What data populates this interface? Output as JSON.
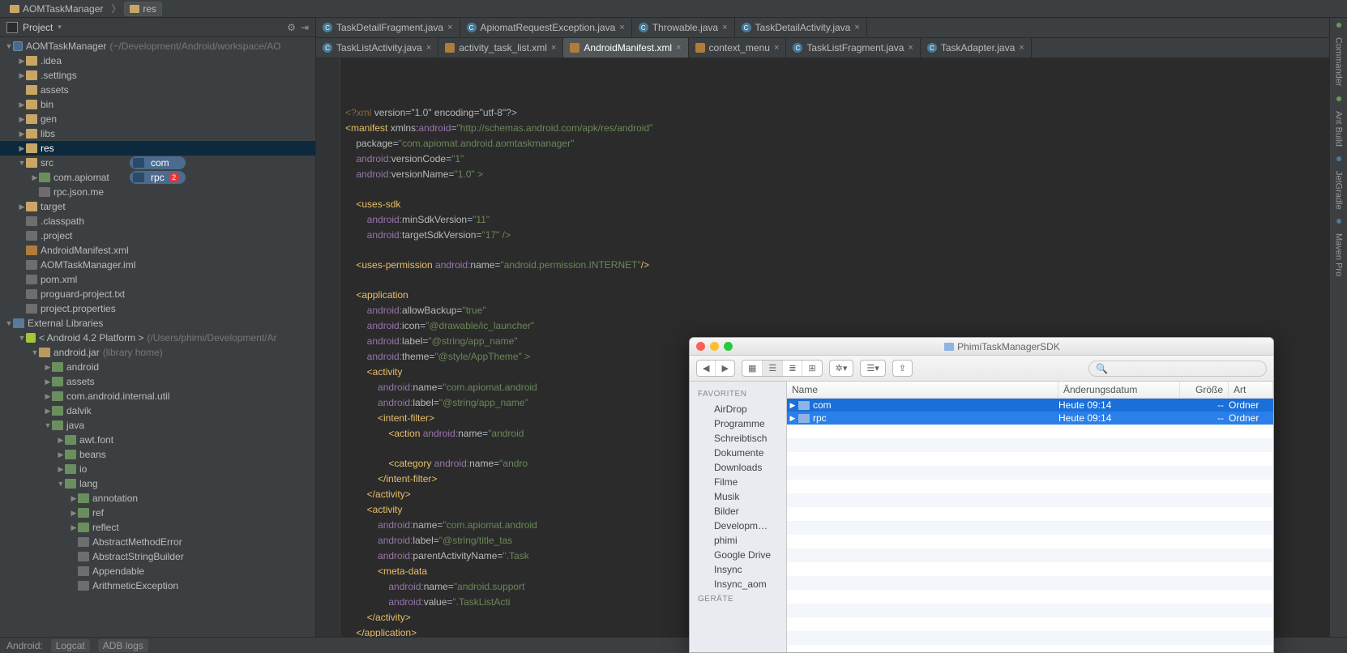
{
  "breadcrumbs": [
    "AOMTaskManager",
    "res"
  ],
  "projectPanel": {
    "title": "Project"
  },
  "tree": [
    {
      "d": 0,
      "t": "v",
      "ic": "module",
      "label": "AOMTaskManager",
      "dim": "(~/Development/Android/workspace/AO"
    },
    {
      "d": 1,
      "t": ">",
      "ic": "folder",
      "label": ".idea"
    },
    {
      "d": 1,
      "t": ">",
      "ic": "folder",
      "label": ".settings"
    },
    {
      "d": 1,
      "t": " ",
      "ic": "folder",
      "label": "assets"
    },
    {
      "d": 1,
      "t": ">",
      "ic": "folder",
      "label": "bin"
    },
    {
      "d": 1,
      "t": ">",
      "ic": "folder",
      "label": "gen"
    },
    {
      "d": 1,
      "t": ">",
      "ic": "folder",
      "label": "libs"
    },
    {
      "d": 1,
      "t": ">",
      "ic": "folder",
      "label": "res",
      "sel": true
    },
    {
      "d": 1,
      "t": "v",
      "ic": "folder",
      "label": "src"
    },
    {
      "d": 2,
      "t": ">",
      "ic": "pkg",
      "label": "com.apiomat"
    },
    {
      "d": 2,
      "t": " ",
      "ic": "file",
      "label": "rpc.json.me"
    },
    {
      "d": 1,
      "t": ">",
      "ic": "folder",
      "label": "target"
    },
    {
      "d": 1,
      "t": " ",
      "ic": "file",
      "label": ".classpath"
    },
    {
      "d": 1,
      "t": " ",
      "ic": "file",
      "label": ".project"
    },
    {
      "d": 1,
      "t": " ",
      "ic": "xml",
      "label": "AndroidManifest.xml"
    },
    {
      "d": 1,
      "t": " ",
      "ic": "file",
      "label": "AOMTaskManager.iml"
    },
    {
      "d": 1,
      "t": " ",
      "ic": "file",
      "label": "pom.xml"
    },
    {
      "d": 1,
      "t": " ",
      "ic": "file",
      "label": "proguard-project.txt"
    },
    {
      "d": 1,
      "t": " ",
      "ic": "file",
      "label": "project.properties"
    },
    {
      "d": 0,
      "t": "v",
      "ic": "lib",
      "label": "External Libraries"
    },
    {
      "d": 1,
      "t": "v",
      "ic": "robot",
      "label": "< Android 4.2 Platform >",
      "dim": "(/Users/phimi/Development/Ar"
    },
    {
      "d": 2,
      "t": "v",
      "ic": "jar",
      "label": "android.jar",
      "dim": "(library home)"
    },
    {
      "d": 3,
      "t": ">",
      "ic": "pkg",
      "label": "android"
    },
    {
      "d": 3,
      "t": ">",
      "ic": "pkg",
      "label": "assets"
    },
    {
      "d": 3,
      "t": ">",
      "ic": "pkg",
      "label": "com.android.internal.util"
    },
    {
      "d": 3,
      "t": ">",
      "ic": "pkg",
      "label": "dalvik"
    },
    {
      "d": 3,
      "t": "v",
      "ic": "pkg",
      "label": "java"
    },
    {
      "d": 4,
      "t": ">",
      "ic": "pkg",
      "label": "awt.font"
    },
    {
      "d": 4,
      "t": ">",
      "ic": "pkg",
      "label": "beans"
    },
    {
      "d": 4,
      "t": ">",
      "ic": "pkg",
      "label": "io"
    },
    {
      "d": 4,
      "t": "v",
      "ic": "pkg",
      "label": "lang"
    },
    {
      "d": 5,
      "t": ">",
      "ic": "pkg",
      "label": "annotation"
    },
    {
      "d": 5,
      "t": ">",
      "ic": "pkg",
      "label": "ref"
    },
    {
      "d": 5,
      "t": ">",
      "ic": "pkg",
      "label": "reflect"
    },
    {
      "d": 5,
      "t": " ",
      "ic": "file",
      "label": "AbstractMethodError"
    },
    {
      "d": 5,
      "t": " ",
      "ic": "file",
      "label": "AbstractStringBuilder"
    },
    {
      "d": 5,
      "t": " ",
      "ic": "file",
      "label": "Appendable"
    },
    {
      "d": 5,
      "t": " ",
      "ic": "file",
      "label": "ArithmeticException"
    }
  ],
  "chips": [
    {
      "label": "com"
    },
    {
      "label": "rpc",
      "badge": "2"
    }
  ],
  "tabsTop": [
    {
      "ic": "c",
      "label": "TaskDetailFragment.java"
    },
    {
      "ic": "c",
      "label": "ApiomatRequestException.java"
    },
    {
      "ic": "c",
      "label": "Throwable.java"
    },
    {
      "ic": "c",
      "label": "TaskDetailActivity.java"
    }
  ],
  "tabsBottom": [
    {
      "ic": "c",
      "label": "TaskListActivity.java"
    },
    {
      "ic": "x",
      "label": "activity_task_list.xml"
    },
    {
      "ic": "x",
      "label": "AndroidManifest.xml",
      "active": true
    },
    {
      "ic": "x",
      "label": "context_menu"
    },
    {
      "ic": "c",
      "label": "TaskListFragment.java"
    },
    {
      "ic": "c",
      "label": "TaskAdapter.java"
    }
  ],
  "status": {
    "items": [
      "Android:",
      "Logcat",
      "ADB logs"
    ]
  },
  "rstrip": [
    "Commander",
    "Ant Build",
    "JetGradle",
    "Maven Pro"
  ],
  "finder": {
    "title": "PhimiTaskManagerSDK",
    "favHead": "FAVORITEN",
    "devHead": "GERÄTE",
    "fav": [
      "AirDrop",
      "Programme",
      "Schreibtisch",
      "Dokumente",
      "Downloads",
      "Filme",
      "Musik",
      "Bilder",
      "Developm…",
      "phimi",
      "Google Drive",
      "Insync",
      "Insync_aom"
    ],
    "columns": [
      "Name",
      "Änderungsdatum",
      "Größe",
      "Art"
    ],
    "rows": [
      {
        "name": "com",
        "date": "Heute 09:14",
        "size": "--",
        "kind": "Ordner"
      },
      {
        "name": "rpc",
        "date": "Heute 09:14",
        "size": "--",
        "kind": "Ordner"
      }
    ],
    "searchPlaceholder": ""
  },
  "code": {
    "l01a": "<?xml ",
    "l01b": "version",
    "l01c": "=\"1.0\" ",
    "l01d": "encoding",
    "l01e": "=\"utf-8\"?>",
    "l02a": "<manifest ",
    "l02b": "xmlns:",
    "l02c": "android",
    "l02d": "=",
    "l02e": "\"http://schemas.android.com/apk/res/android\"",
    "l03a": "    package",
    "l03b": "=",
    "l03c": "\"com.apiomat.android.aomtaskmanager\"",
    "l04a": "    ",
    "l04b": "android:",
    "l04c": "versionCode",
    "l04d": "=",
    "l04e": "\"1\"",
    "l05a": "    ",
    "l05b": "android:",
    "l05c": "versionName",
    "l05d": "=",
    "l05e": "\"1.0\" >",
    "l07a": "    <uses-sdk",
    "l08a": "        ",
    "l08b": "android:",
    "l08c": "minSdkVersion",
    "l08d": "=",
    "l08e": "\"11\"",
    "l09a": "        ",
    "l09b": "android:",
    "l09c": "targetSdkVersion",
    "l09d": "=",
    "l09e": "\"17\" />",
    "l11a": "    <uses-permission ",
    "l11b": "android:",
    "l11c": "name",
    "l11d": "=",
    "l11e": "\"android.permission.INTERNET\"",
    "l11f": "/>",
    "l13a": "    <application",
    "l14a": "        ",
    "l14b": "android:",
    "l14c": "allowBackup",
    "l14d": "=",
    "l14e": "\"true\"",
    "l15a": "        ",
    "l15b": "android:",
    "l15c": "icon",
    "l15d": "=",
    "l15e": "\"@drawable/ic_launcher\"",
    "l16a": "        ",
    "l16b": "android:",
    "l16c": "label",
    "l16d": "=",
    "l16e": "\"@string/app_name\"",
    "l17a": "        ",
    "l17b": "android:",
    "l17c": "theme",
    "l17d": "=",
    "l17e": "\"@style/AppTheme\" >",
    "l18a": "        <activity",
    "l19a": "            ",
    "l19b": "android:",
    "l19c": "name",
    "l19d": "=",
    "l19e": "\"com.apiomat.android",
    "l20a": "            ",
    "l20b": "android:",
    "l20c": "label",
    "l20d": "=",
    "l20e": "\"@string/app_name\"",
    "l21a": "            <intent-filter>",
    "l22a": "                <action ",
    "l22b": "android:",
    "l22c": "name",
    "l22d": "=",
    "l22e": "\"android",
    "l24a": "                <category ",
    "l24b": "android:",
    "l24c": "name",
    "l24d": "=",
    "l24e": "\"andro",
    "l25a": "            </intent-filter>",
    "l26a": "        </activity>",
    "l27a": "        <activity",
    "l28a": "            ",
    "l28b": "android:",
    "l28c": "name",
    "l28d": "=",
    "l28e": "\"com.apiomat.android",
    "l29a": "            ",
    "l29b": "android:",
    "l29c": "label",
    "l29d": "=",
    "l29e": "\"@string/title_tas",
    "l30a": "            ",
    "l30b": "android:",
    "l30c": "parentActivityName",
    "l30d": "=",
    "l30e": "\".Task",
    "l31a": "            <meta-data",
    "l32a": "                ",
    "l32b": "android:",
    "l32c": "name",
    "l32d": "=",
    "l32e": "\"android.support",
    "l33a": "                ",
    "l33b": "android:",
    "l33c": "value",
    "l33d": "=",
    "l33e": "\".TaskListActi",
    "l34a": "        </activity>",
    "l35a": "    </application>"
  }
}
